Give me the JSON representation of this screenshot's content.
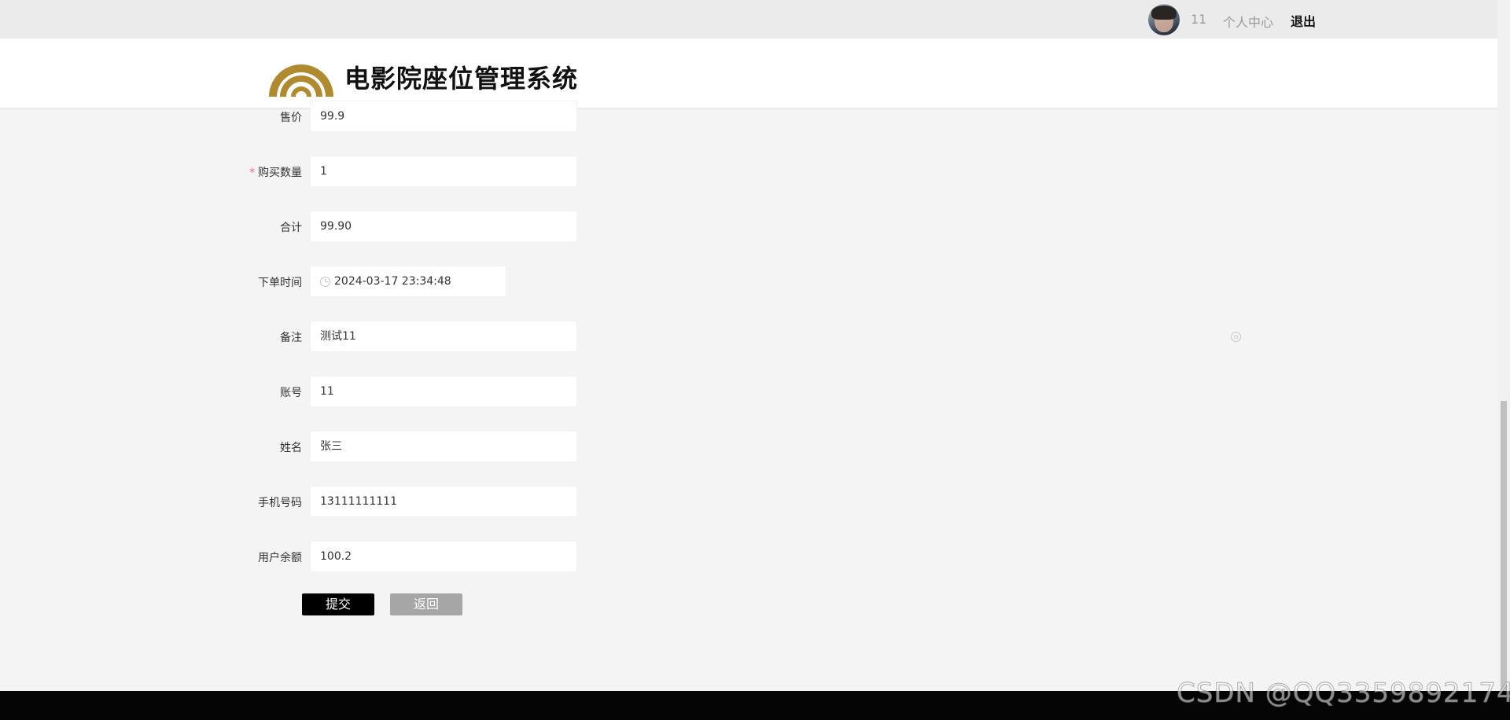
{
  "topbar": {
    "username": "11",
    "user_center": "个人中心",
    "logout": "退出"
  },
  "header": {
    "site_title": "电影院座位管理系统"
  },
  "form": {
    "price": {
      "label": "售价",
      "value": "99.9"
    },
    "quantity": {
      "required_mark": "*",
      "label": "购买数量",
      "value": "1"
    },
    "total": {
      "label": "合计",
      "value": "99.90"
    },
    "order_time": {
      "label": "下单时间",
      "value": "2024-03-17 23:34:48"
    },
    "remark": {
      "label": "备注",
      "value": "测试11"
    },
    "account": {
      "label": "账号",
      "value": "11"
    },
    "name": {
      "label": "姓名",
      "value": "张三"
    },
    "phone": {
      "label": "手机号码",
      "value": "13111111111"
    },
    "balance": {
      "label": "用户余额",
      "value": "100.2"
    }
  },
  "buttons": {
    "submit": "提交",
    "back": "返回"
  },
  "watermark": "CSDN @QQ3359892174",
  "colors": {
    "accent_gold": "#b08a2e",
    "submit_bg": "#000000",
    "back_bg": "#a6a6a6"
  }
}
